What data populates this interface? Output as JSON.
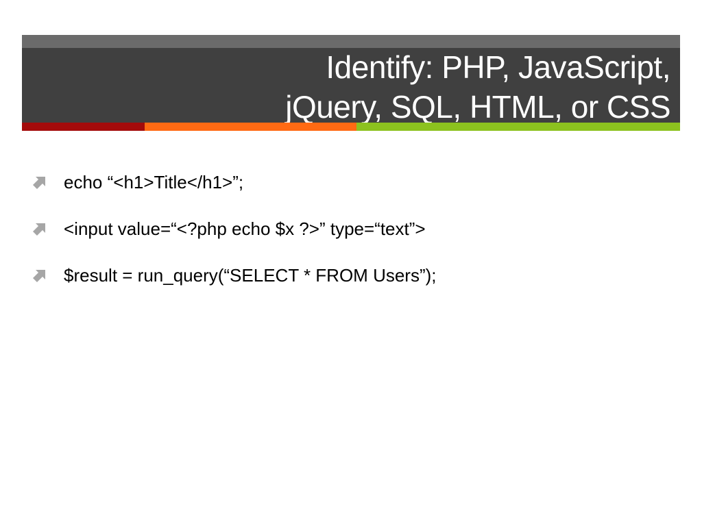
{
  "slide": {
    "title_lines": [
      "Identify: PHP, JavaScript,",
      "jQuery, SQL, HTML, or CSS"
    ],
    "colors": {
      "title_band": "#404040",
      "title_band_top": "#6b6b6b",
      "title_text": "#ffffff",
      "accent_red": "#a30b0b",
      "accent_orange": "#ff6a13",
      "accent_green": "#8cc21f",
      "bullet_icon": "#a6a6a6"
    },
    "bullet_icon": "arrow-up-right-icon",
    "bullets": [
      "echo “<h1>Title</h1>”;",
      "<input value=“<?php echo $x ?>” type=“text”>",
      "$result = run_query(“SELECT * FROM Users”);"
    ]
  }
}
